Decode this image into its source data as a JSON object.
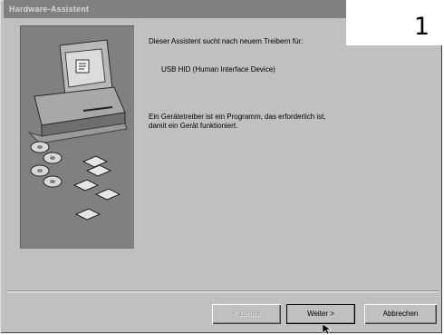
{
  "window": {
    "title": "Hardware-Assistent"
  },
  "step": {
    "number": "1"
  },
  "content": {
    "intro": "Dieser Assistent sucht nach neuem Treibern für:",
    "device": "USB HID (Human Interface Device)",
    "info_line1": "Ein Gerätetreiber ist ein Programm, das erforderlich ist,",
    "info_line2": "damit ein Gerät funktioniert."
  },
  "buttons": {
    "back": "< Zurück",
    "next": "Weiter >",
    "cancel": "Abbrechen"
  },
  "colors": {
    "dialog_background": "#c0c0c0",
    "title_bar": "#808080",
    "illustration_panel": "#808080"
  },
  "icons": [
    "computer-icon",
    "discs-icon",
    "mouse-pointer-icon"
  ]
}
